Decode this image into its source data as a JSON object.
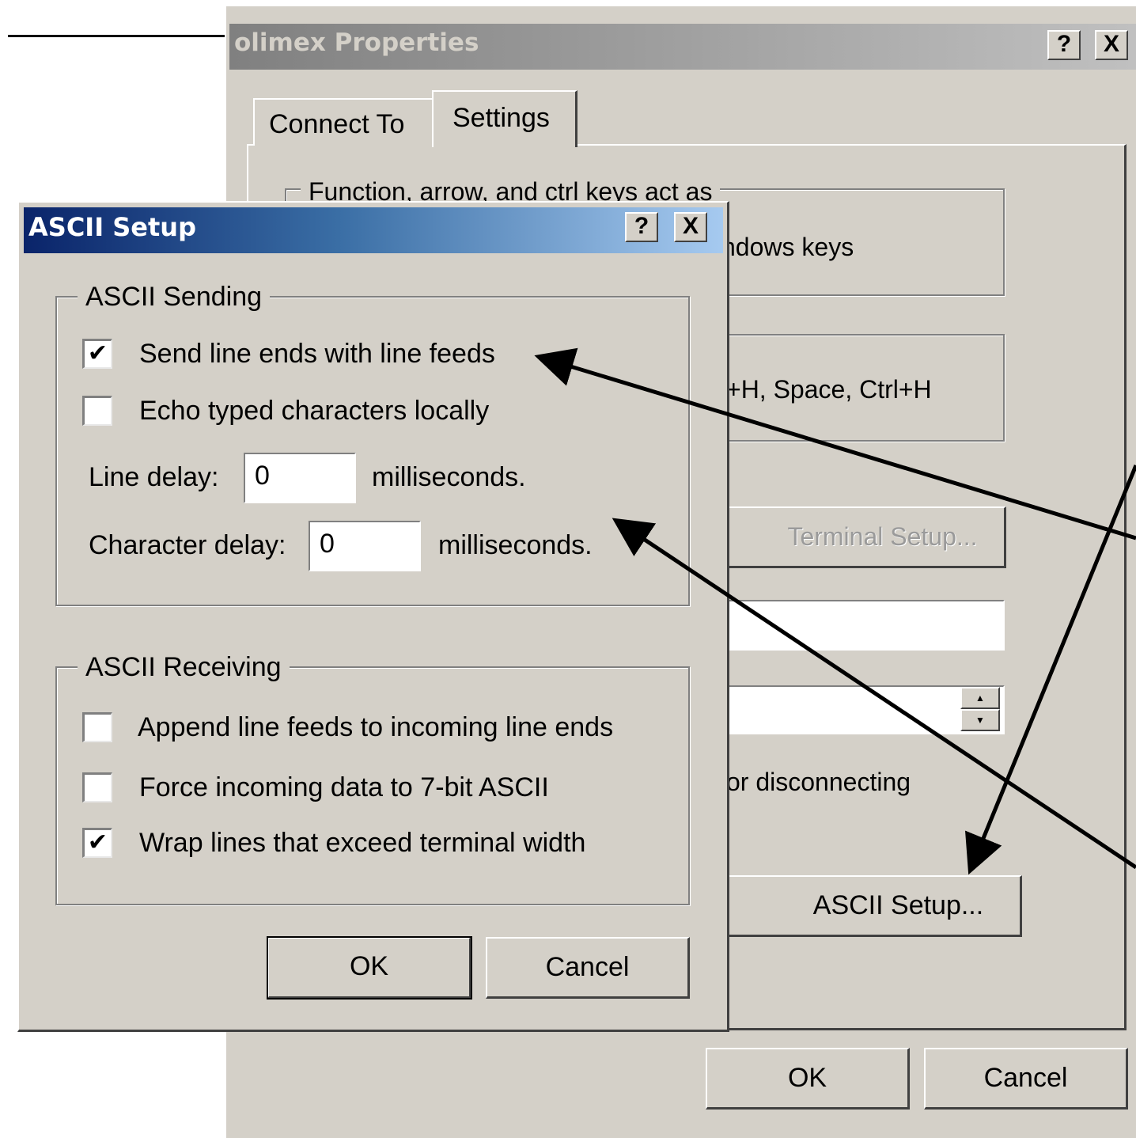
{
  "back_dialog": {
    "title": "olimex Properties",
    "help_btn": "?",
    "close_btn": "X",
    "tabs": [
      "Connect To",
      "Settings"
    ],
    "fkeys_group_label": "Function, arrow, and ctrl keys act as",
    "fkeys_option_visible": "ndows keys",
    "backspace_option_visible": "+H, Space, Ctrl+H",
    "terminal_setup_btn": "Terminal Setup...",
    "disconnect_text_visible": "or disconnecting",
    "ascii_setup_btn": "ASCII Setup...",
    "ok_btn": "OK",
    "cancel_btn": "Cancel"
  },
  "ascii_dialog": {
    "title": "ASCII Setup",
    "help_btn": "?",
    "close_btn": "X",
    "sending_group": "ASCII Sending",
    "send_line_ends": {
      "label": "Send line ends with line feeds",
      "checked": true
    },
    "echo_local": {
      "label": "Echo typed characters locally",
      "checked": false
    },
    "line_delay": {
      "label": "Line delay:",
      "value": "0",
      "unit": "milliseconds."
    },
    "char_delay": {
      "label": "Character delay:",
      "value": "0",
      "unit": "milliseconds."
    },
    "receiving_group": "ASCII Receiving",
    "append_lf": {
      "label": "Append line feeds to incoming line ends",
      "checked": false
    },
    "force_7bit": {
      "label": "Force incoming data to 7-bit ASCII",
      "checked": false
    },
    "wrap_lines": {
      "label": "Wrap lines that exceed terminal width",
      "checked": true
    },
    "ok_btn": "OK",
    "cancel_btn": "Cancel"
  },
  "colors": {
    "dialog_face": "#d4d0c8",
    "inactive_title": "#808080",
    "active_title_start": "#0a246a",
    "active_title_end": "#a6caf0"
  },
  "icons": [
    "check-mark",
    "help-question",
    "close-x",
    "spinner-arrows"
  ]
}
